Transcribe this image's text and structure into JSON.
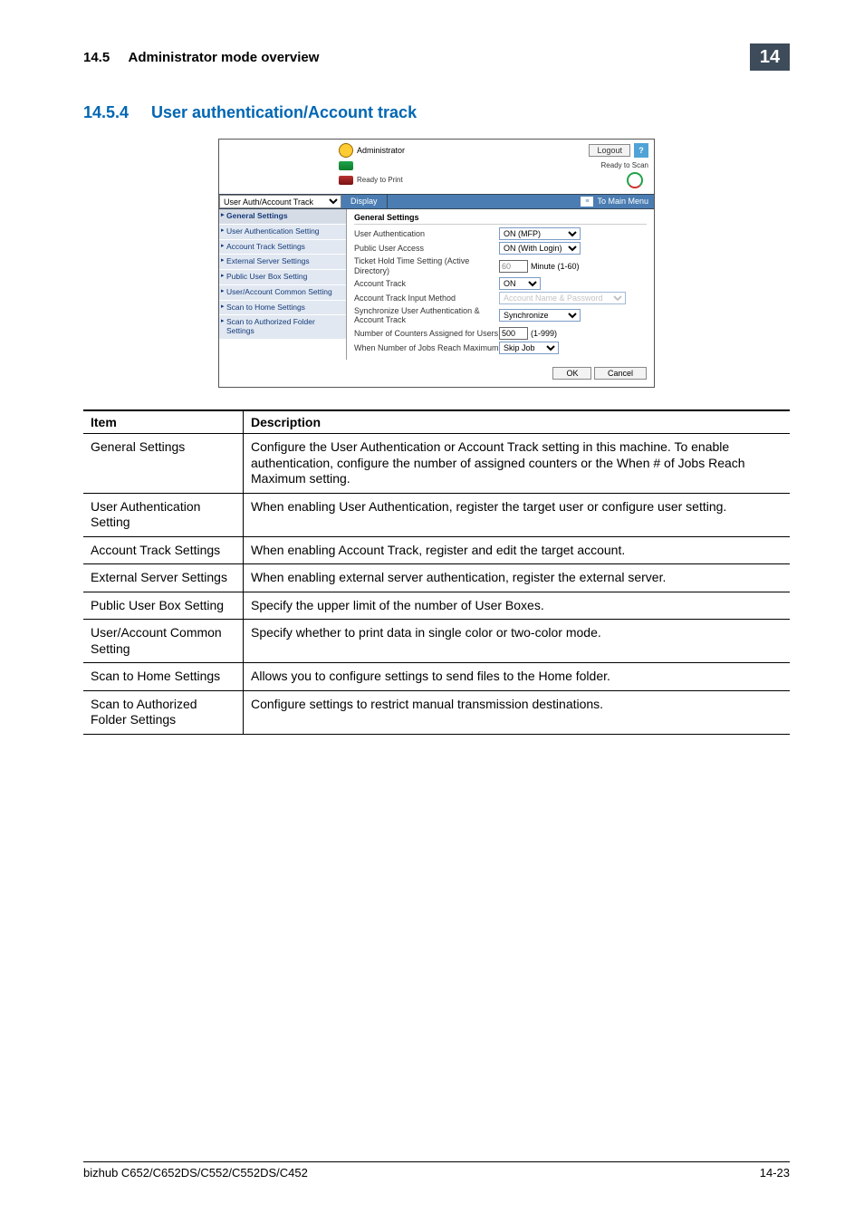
{
  "header": {
    "section_label": "14.5",
    "section_title": "Administrator mode overview",
    "chapter_badge": "14"
  },
  "title": {
    "number": "14.5.4",
    "text": "User authentication/Account track"
  },
  "shot": {
    "admin_label": "Administrator",
    "logout": "Logout",
    "help": "?",
    "ready_scan": "Ready to Scan",
    "ready_print": "Ready to Print",
    "tab_select": "User Auth/Account Track",
    "display_btn": "Display",
    "to_main": "To Main Menu",
    "side": {
      "items": [
        "General Settings",
        "User Authentication Setting",
        "Account Track Settings",
        "External Server Settings",
        "Public User Box Setting",
        "User/Account Common Setting",
        "Scan to Home Settings",
        "Scan to Authorized Folder Settings"
      ]
    },
    "form": {
      "title": "General Settings",
      "rows": [
        {
          "label": "User Authentication",
          "type": "select",
          "value": "ON (MFP)"
        },
        {
          "label": "Public User Access",
          "type": "select",
          "value": "ON (With Login)"
        },
        {
          "label": "Ticket Hold Time Setting (Active Directory)",
          "type": "input_suffix",
          "value": "60",
          "suffix": "Minute (1-60)"
        },
        {
          "label": "Account Track",
          "type": "select",
          "value": "ON"
        },
        {
          "label": "Account Track Input Method",
          "type": "select_disabled",
          "value": "Account Name & Password"
        },
        {
          "label": "Synchronize User Authentication & Account Track",
          "type": "select",
          "value": "Synchronize"
        },
        {
          "label": "Number of Counters Assigned for Users",
          "type": "input_suffix",
          "value": "500",
          "suffix": "(1-999)"
        },
        {
          "label": "When Number of Jobs Reach Maximum",
          "type": "select",
          "value": "Skip Job"
        }
      ],
      "ok": "OK",
      "cancel": "Cancel"
    }
  },
  "table": {
    "head": {
      "item": "Item",
      "desc": "Description"
    },
    "rows": [
      {
        "item": "General Settings",
        "desc": "Configure the User Authentication or Account Track setting in this machine. To enable authentication, configure the number of assigned counters or the When # of Jobs Reach Maximum setting."
      },
      {
        "item": "User Authentication Setting",
        "desc": "When enabling User Authentication, register the target user or configure user setting."
      },
      {
        "item": "Account Track Settings",
        "desc": "When enabling Account Track, register and edit the target account."
      },
      {
        "item": "External Server Settings",
        "desc": "When enabling external server authentication, register the external server."
      },
      {
        "item": "Public User Box Setting",
        "desc": "Specify the upper limit of the number of User Boxes."
      },
      {
        "item": "User/Account Common Setting",
        "desc": "Specify whether to print data in single color or two-color mode."
      },
      {
        "item": "Scan to Home Settings",
        "desc": "Allows you to configure settings to send files to the Home folder."
      },
      {
        "item": "Scan to Authorized Folder Settings",
        "desc": "Configure settings to restrict manual transmission destinations."
      }
    ]
  },
  "footer": {
    "left": "bizhub C652/C652DS/C552/C552DS/C452",
    "right": "14-23"
  }
}
